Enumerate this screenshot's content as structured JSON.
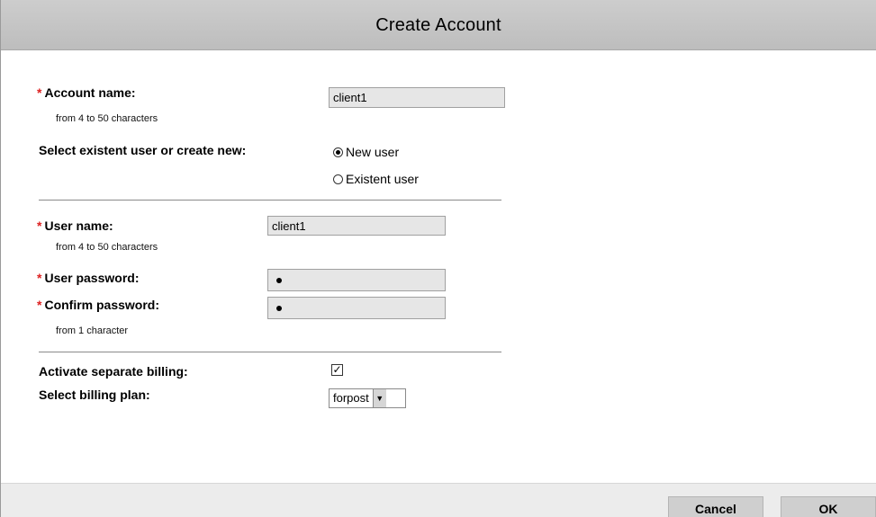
{
  "dialog": {
    "title": "Create Account"
  },
  "account": {
    "required_mark": "*",
    "label": "Account name:",
    "hint": "from 4 to 50 characters",
    "value": "client1"
  },
  "user_choice": {
    "label": "Select existent user or create new:",
    "options": [
      {
        "label": "New user",
        "selected": true
      },
      {
        "label": "Existent user",
        "selected": false
      }
    ]
  },
  "user": {
    "required_mark": "*",
    "name_label": "User name:",
    "name_hint": "from 4 to 50 characters",
    "name_value": "client1",
    "password_label": "User password:",
    "confirm_label": "Confirm password:",
    "password_hint": "from 1 character"
  },
  "billing": {
    "activate_label": "Activate separate billing:",
    "activate_checked": true,
    "check_glyph": "✓",
    "plan_label": "Select billing plan:",
    "plan_value": "forpost",
    "dropdown_glyph": "▼"
  },
  "footer": {
    "cancel_label": "Cancel",
    "ok_label": "OK"
  }
}
